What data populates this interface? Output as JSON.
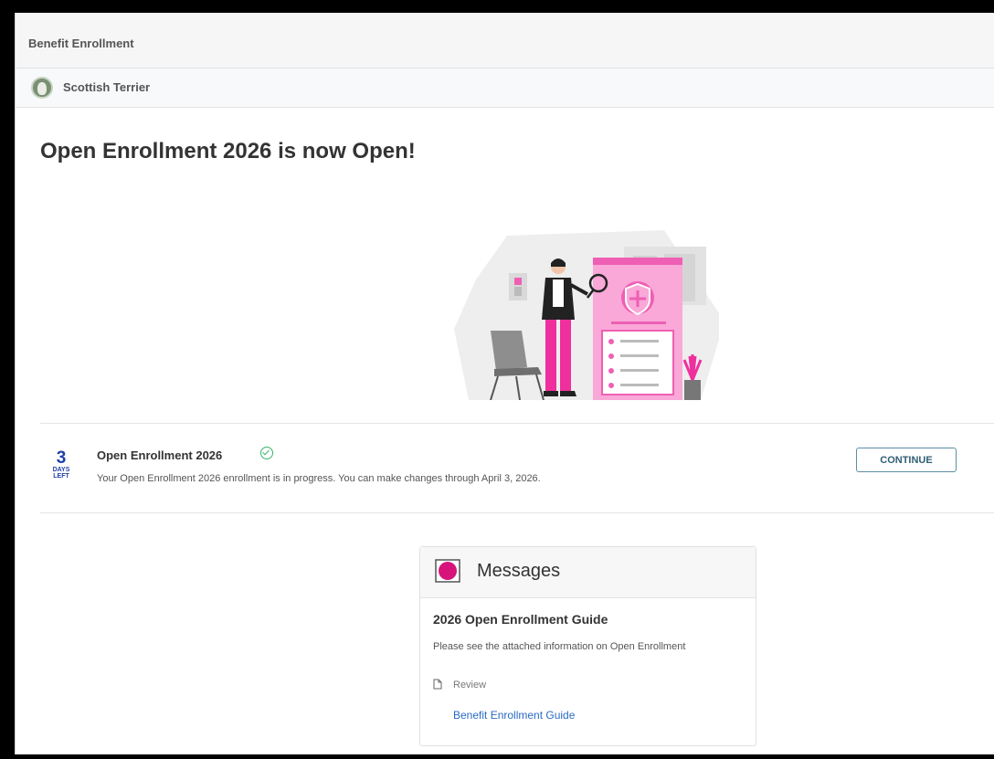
{
  "header": {
    "title": "Benefit Enrollment"
  },
  "employee": {
    "name": "Scottish Terrier"
  },
  "main": {
    "headline": "Open Enrollment 2026 is now Open!"
  },
  "enrollment": {
    "days_left_number": "3",
    "days_label_1": "DAYS",
    "days_label_2": "LEFT",
    "title": "Open Enrollment 2026",
    "status_icon": "check-circle-icon",
    "description": "Your Open Enrollment 2026 enrollment is in progress. You can make changes through April 3, 2026.",
    "continue_label": "CONTINUE"
  },
  "messages": {
    "heading": "Messages",
    "item_title": "2026 Open Enrollment Guide",
    "item_body": "Please see the attached information on Open Enrollment",
    "review_label": "Review",
    "link_label": "Benefit Enrollment Guide"
  },
  "colors": {
    "accent_pink": "#ef5fb4",
    "days_blue": "#1f3fa8",
    "link_blue": "#2a6bc4",
    "button_border": "#5b8fa6",
    "success_green": "#3ab26b"
  }
}
